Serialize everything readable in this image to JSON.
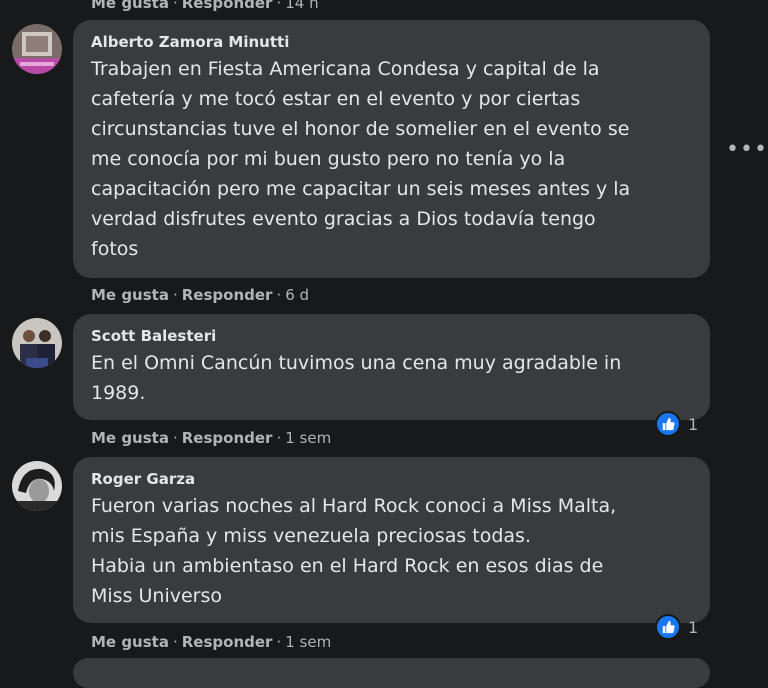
{
  "top_actions": {
    "like": "Me gusta",
    "reply": "Responder",
    "time": "14 h"
  },
  "comments": [
    {
      "author": "Alberto Zamora Minutti",
      "text": "Trabajen en Fiesta Americana Condesa y capital de la\ncafetería y me tocó estar en el evento y por ciertas\ncircunstancias tuve el honor de somelier en el evento se\nme conocía por mi buen gusto pero no tenía yo la\ncapacitación pero me capacitar un seis meses antes y la\nverdad disfrutes evento gracias a Dios todavía tengo\nfotos",
      "like": "Me gusta",
      "reply": "Responder",
      "time": "6 d",
      "more_icon": "•••"
    },
    {
      "author": "Scott Balesteri",
      "text": "En el Omni Cancún tuvimos una cena muy agradable in\n1989.",
      "like": "Me gusta",
      "reply": "Responder",
      "time": "1 sem",
      "reactions": "1"
    },
    {
      "author": "Roger Garza",
      "text": "Fueron varias noches al Hard Rock conoci a Miss Malta,\nmis España y miss venezuela preciosas todas.\nHabia un ambientaso en el Hard Rock en esos dias de\nMiss Universo",
      "like": "Me gusta",
      "reply": "Responder",
      "time": "1 sem",
      "reactions": "1"
    }
  ],
  "separator": "·",
  "colors": {
    "background": "#18191a",
    "bubble": "#3a3b3c",
    "like_blue": "#1877f2"
  }
}
